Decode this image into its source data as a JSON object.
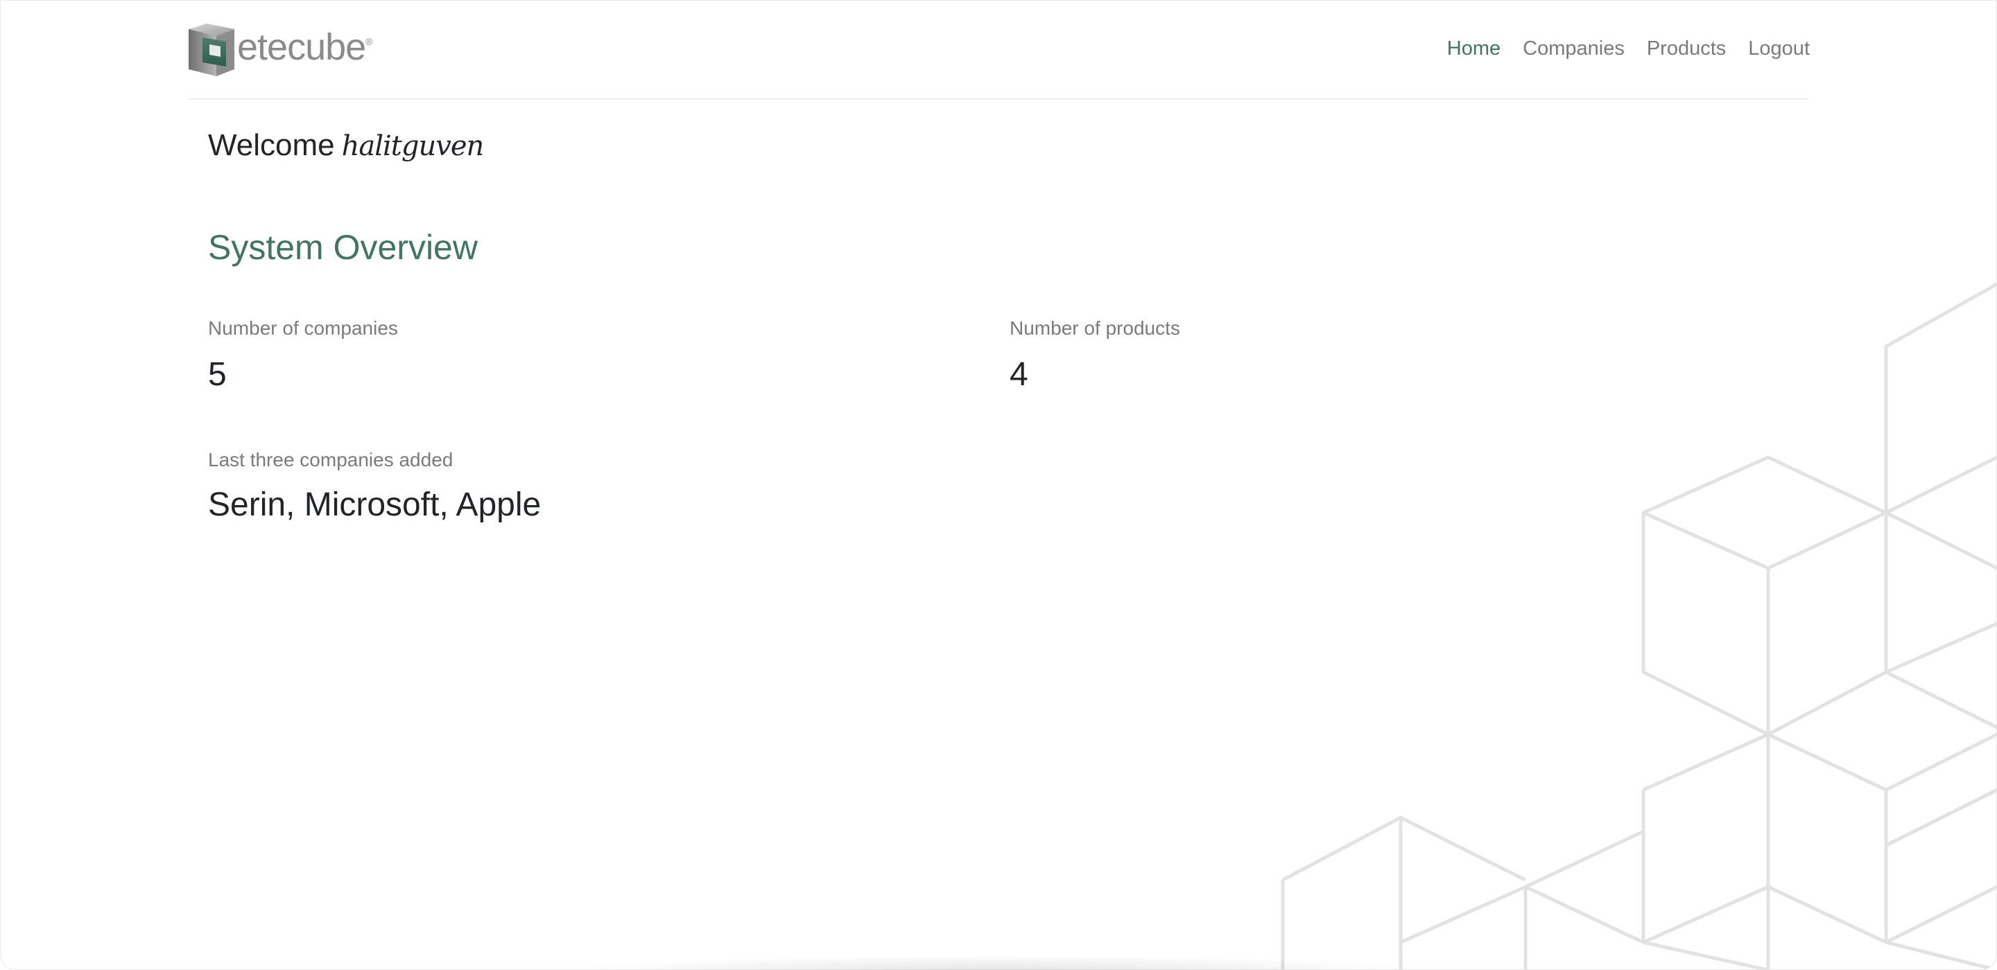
{
  "brand": {
    "name": "etecube",
    "registered": "®",
    "logo_icon": "cube-logo-icon"
  },
  "nav": {
    "items": [
      {
        "label": "Home",
        "active": true
      },
      {
        "label": "Companies",
        "active": false
      },
      {
        "label": "Products",
        "active": false
      },
      {
        "label": "Logout",
        "active": false
      }
    ]
  },
  "welcome": {
    "prefix": "Welcome",
    "username": "halitguven"
  },
  "overview": {
    "title": "System Overview",
    "companies_label": "Number of companies",
    "companies_count": "5",
    "products_label": "Number of products",
    "products_count": "4",
    "last_label": "Last three companies added",
    "last_value": "Serin, Microsoft, Apple"
  },
  "colors": {
    "accent": "#3f7562",
    "muted": "#7a7a7a",
    "text": "#212529"
  }
}
